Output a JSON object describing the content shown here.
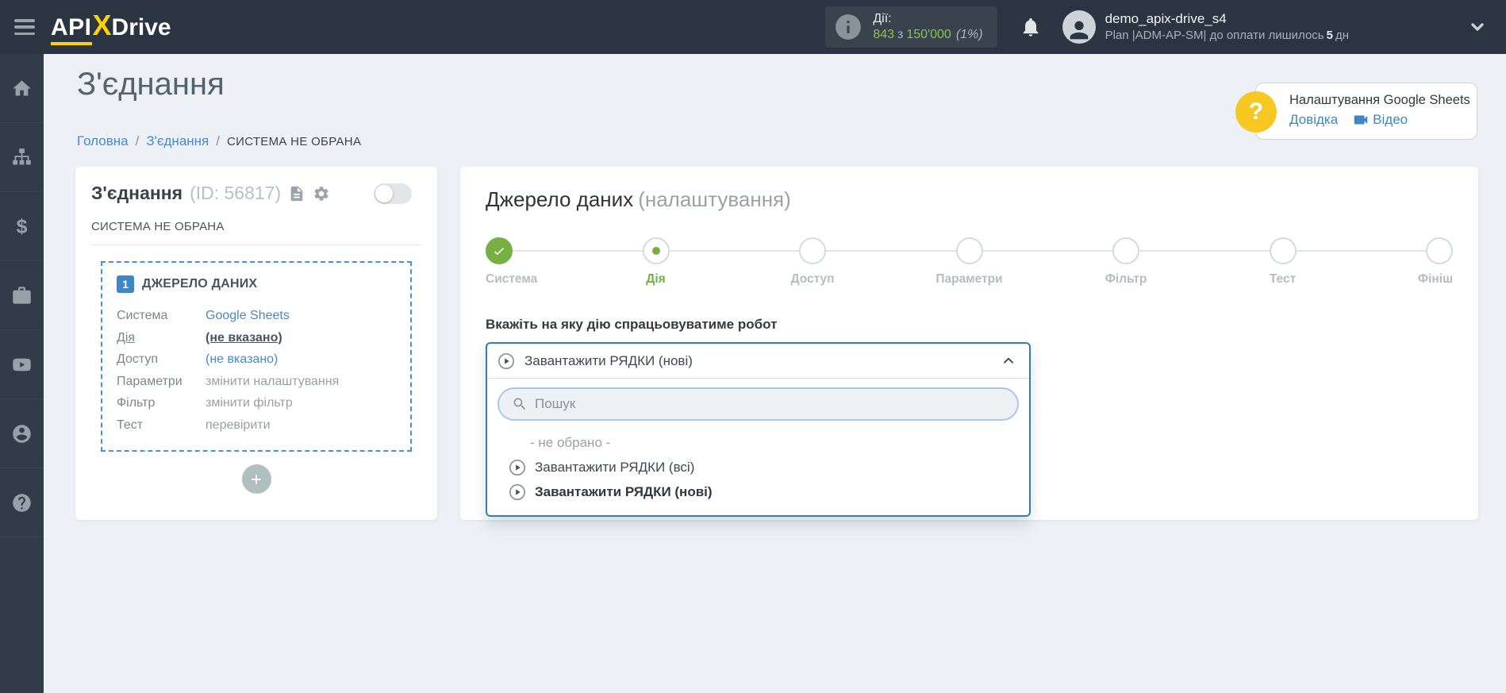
{
  "topbar": {
    "logo_part_api": "API",
    "logo_part_x": "X",
    "logo_part_drive": "Drive",
    "counter": {
      "label": "Дії:",
      "used": "843",
      "conjunction": "з",
      "total": "150'000",
      "percent": "(1%)"
    },
    "user": {
      "name": "demo_apix-drive_s4",
      "plan_prefix": "Plan |ADM-AP-SM| до оплати лишилось",
      "days_left": "5",
      "days_unit": "дн"
    }
  },
  "sidebar": {
    "items": [
      {
        "icon": "home-icon"
      },
      {
        "icon": "connections-icon"
      },
      {
        "icon": "billing-icon"
      },
      {
        "icon": "services-icon"
      },
      {
        "icon": "video-tutorials-icon"
      },
      {
        "icon": "account-icon"
      },
      {
        "icon": "help-icon"
      }
    ]
  },
  "page": {
    "title": "З'єднання",
    "breadcrumb": {
      "home": "Головна",
      "section": "З'єднання",
      "current": "СИСТЕМА НЕ ОБРАНА",
      "separator": "/"
    },
    "help_box": {
      "icon_char": "?",
      "title": "Налаштування Google Sheets",
      "docs_link": "Довідка",
      "video_link": "Відео"
    }
  },
  "connection_card": {
    "title": "З'єднання",
    "id_label": "(ID: 56817)",
    "system_status": "СИСТЕМА НЕ ОБРАНА",
    "data_source": {
      "step_number": "1",
      "title": "ДЖЕРЕЛО ДАНИХ",
      "rows": [
        {
          "label": "Система",
          "value": "Google Sheets"
        },
        {
          "label": "Дія",
          "value": "(не вказано)"
        },
        {
          "label": "Доступ",
          "value": "(не вказано)"
        },
        {
          "label": "Параметри",
          "value": "змінити налаштування"
        },
        {
          "label": "Фільтр",
          "value": "змінити фільтр"
        },
        {
          "label": "Тест",
          "value": "перевірити"
        }
      ]
    }
  },
  "settings_panel": {
    "title": "Джерело даних",
    "title_note": "(налаштування)",
    "steps": [
      {
        "label": "Система",
        "state": "done"
      },
      {
        "label": "Дія",
        "state": "active"
      },
      {
        "label": "Доступ",
        "state": "pending"
      },
      {
        "label": "Параметри",
        "state": "pending"
      },
      {
        "label": "Фільтр",
        "state": "pending"
      },
      {
        "label": "Тест",
        "state": "pending"
      },
      {
        "label": "Фініш",
        "state": "pending"
      }
    ],
    "action_question": "Вкажіть на яку дію спрацьовуватиме робот",
    "action_dropdown": {
      "selected_option": "Завантажити РЯДКИ (нові)",
      "search_placeholder": "Пошук",
      "options": [
        "- не обрано -",
        "Завантажити РЯДКИ (всі)",
        "Завантажити РЯДКИ (нові)"
      ]
    }
  },
  "colors": {
    "topbar_bg": "#2b3541",
    "brand_yellow": "#ffd200",
    "accent_blue": "#4a88c7",
    "dashed_border_blue": "#4a90d9",
    "dropdown_border_blue": "#2d7fb8",
    "stepper_green": "#76b042",
    "counter_green": "#8bc34a",
    "help_circle_yellow": "#f8c822"
  }
}
